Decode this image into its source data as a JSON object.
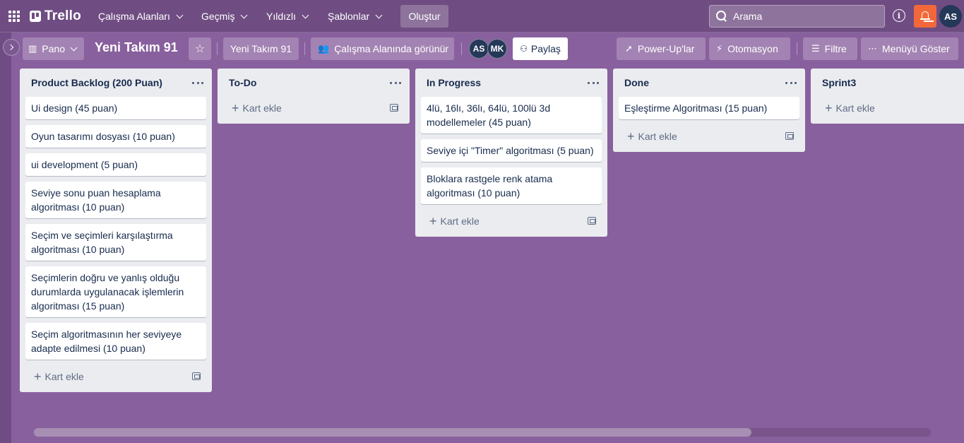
{
  "app": {
    "name": "Trello"
  },
  "nav": {
    "workspaces": "Çalışma Alanları",
    "recent": "Geçmiş",
    "starred": "Yıldızlı",
    "templates": "Şablonlar",
    "create": "Oluştur"
  },
  "search": {
    "placeholder": "Arama"
  },
  "user": {
    "initials": "AS"
  },
  "board": {
    "view": "Pano",
    "title": "Yeni Takım 91",
    "workspace": "Yeni Takım 91",
    "visibility": "Çalışma Alanında görünür",
    "members": [
      "AS",
      "MK"
    ],
    "share": "Paylaş",
    "powerups": "Power-Up'lar",
    "automation": "Otomasyon",
    "filter": "Filtre",
    "menu": "Menüyü Göster"
  },
  "add_card_label": "Kart ekle",
  "lists": [
    {
      "title": "Product Backlog (200 Puan)",
      "cards": [
        "Ui design (45 puan)",
        "Oyun tasarımı dosyası (10 puan)",
        "ui development (5 puan)",
        "Seviye sonu puan hesaplama algoritması (10 puan)",
        "Seçim ve seçimleri karşılaştırma algoritması (10 puan)",
        "Seçimlerin doğru ve yanlış olduğu durumlarda uygulanacak işlemlerin algoritması (15 puan)",
        "Seçim algoritmasının her seviyeye adapte edilmesi (10 puan)"
      ]
    },
    {
      "title": "To-Do",
      "cards": []
    },
    {
      "title": "In Progress",
      "cards": [
        "4lü, 16lı, 36lı, 64lü, 100lü 3d modellemeler (45 puan)",
        "Seviye içi \"Timer\" algoritması (5 puan)",
        "Bloklara rastgele renk atama algoritması (10 puan)"
      ]
    },
    {
      "title": "Done",
      "cards": [
        "Eşleştirme Algoritması (15 puan)"
      ]
    },
    {
      "title": "Sprint3",
      "cards": []
    }
  ],
  "colors": {
    "header": "#6f4d82",
    "board_bg": "#89609e",
    "notification": "#f2683a",
    "avatar": "#253858"
  }
}
